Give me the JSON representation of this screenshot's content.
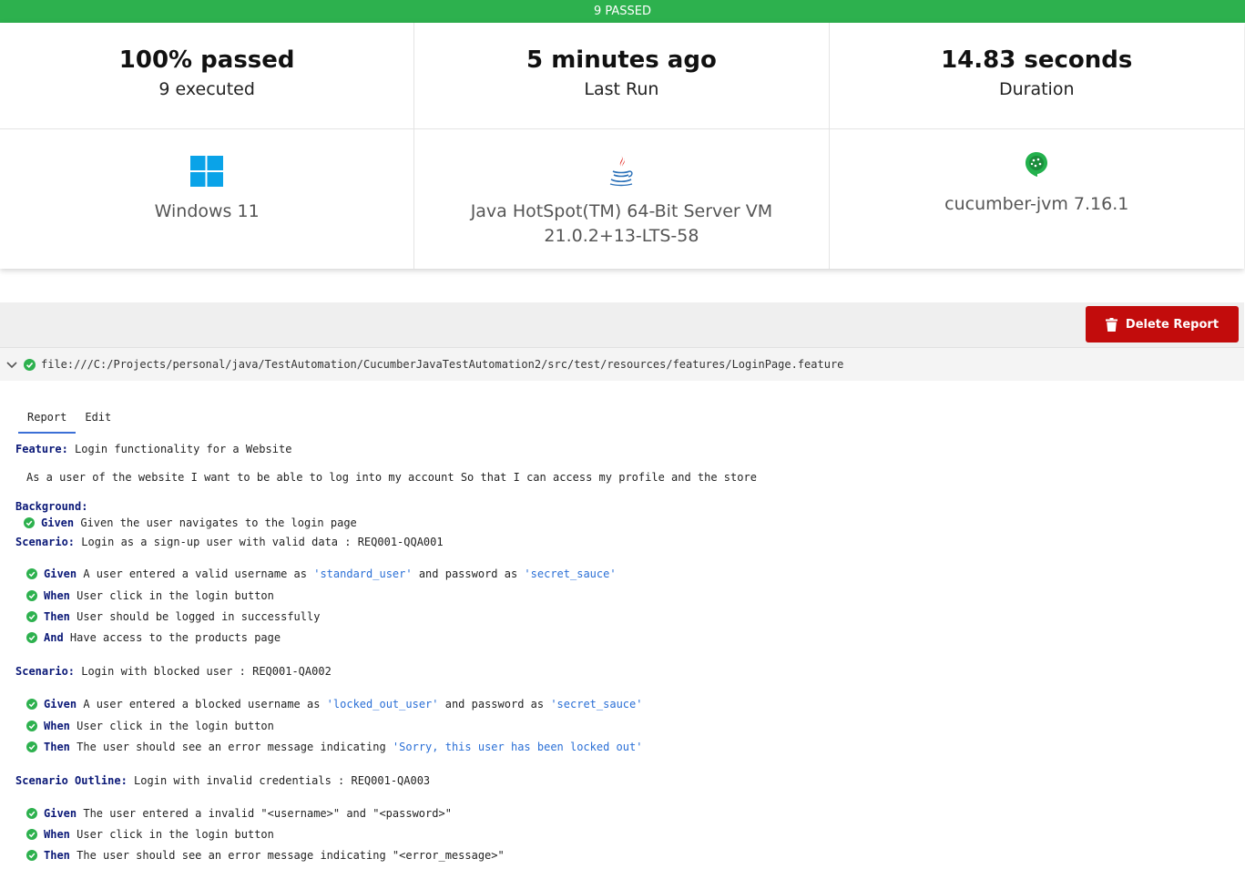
{
  "status_bar": {
    "text": "9 PASSED"
  },
  "stats": [
    {
      "value": "100% passed",
      "label": "9 executed"
    },
    {
      "value": "5 minutes ago",
      "label": "Last Run"
    },
    {
      "value": "14.83 seconds",
      "label": "Duration"
    }
  ],
  "environment": [
    {
      "icon": "windows-icon",
      "label": "Windows 11"
    },
    {
      "icon": "java-icon",
      "label": "Java HotSpot(TM) 64-Bit Server VM",
      "label2": "21.0.2+13-LTS-58"
    },
    {
      "icon": "cucumber-icon",
      "label": "cucumber-jvm 7.16.1"
    }
  ],
  "toolbar": {
    "delete_label": "Delete Report"
  },
  "file": {
    "path": "file:///C:/Projects/personal/java/TestAutomation/CucumberJavaTestAutomation2/src/test/resources/features/LoginPage.feature"
  },
  "tabs": [
    "Report",
    "Edit"
  ],
  "colors": {
    "passed": "#2db14e",
    "delete": "#c20c0c",
    "keyword": "#0a1877",
    "string": "#2a6fd6"
  },
  "feature": {
    "keyword": "Feature:",
    "name": " Login functionality for a Website",
    "description": "As a user of the website I want to be able to log into my account So that I can access my profile and the store",
    "background": {
      "keyword": "Background:",
      "steps": [
        {
          "keyword": "Given",
          "text": " Given the user navigates to the login page"
        }
      ]
    },
    "scenarios": [
      {
        "keyword": "Scenario:",
        "name": " Login as a sign-up user with valid data : REQ001-QQA001",
        "steps": [
          {
            "keyword": "Given",
            "parts": [
              " A user entered a valid username as ",
              "'standard_user'",
              " and password as ",
              "'secret_sauce'"
            ]
          },
          {
            "keyword": "When",
            "parts": [
              " User click in the login button"
            ]
          },
          {
            "keyword": "Then",
            "parts": [
              " User should be logged in successfully"
            ]
          },
          {
            "keyword": "And",
            "parts": [
              " Have access to the products page"
            ]
          }
        ]
      },
      {
        "keyword": "Scenario:",
        "name": " Login with blocked user : REQ001-QA002",
        "steps": [
          {
            "keyword": "Given",
            "parts": [
              " A user entered a blocked username as ",
              "'locked_out_user'",
              " and password as ",
              "'secret_sauce'"
            ]
          },
          {
            "keyword": "When",
            "parts": [
              " User click in the login button"
            ]
          },
          {
            "keyword": "Then",
            "parts": [
              " The user should see an error message indicating ",
              "'Sorry, this user has been locked out'"
            ]
          }
        ]
      },
      {
        "keyword": "Scenario Outline:",
        "name": " Login with invalid credentials : REQ001-QA003",
        "steps": [
          {
            "keyword": "Given",
            "parts": [
              " The user entered a invalid \"<username>\" and \"<password>\""
            ]
          },
          {
            "keyword": "When",
            "parts": [
              " User click in the login button"
            ]
          },
          {
            "keyword": "Then",
            "parts": [
              " The user should see an error message indicating \"<error_message>\""
            ]
          }
        ]
      }
    ]
  }
}
